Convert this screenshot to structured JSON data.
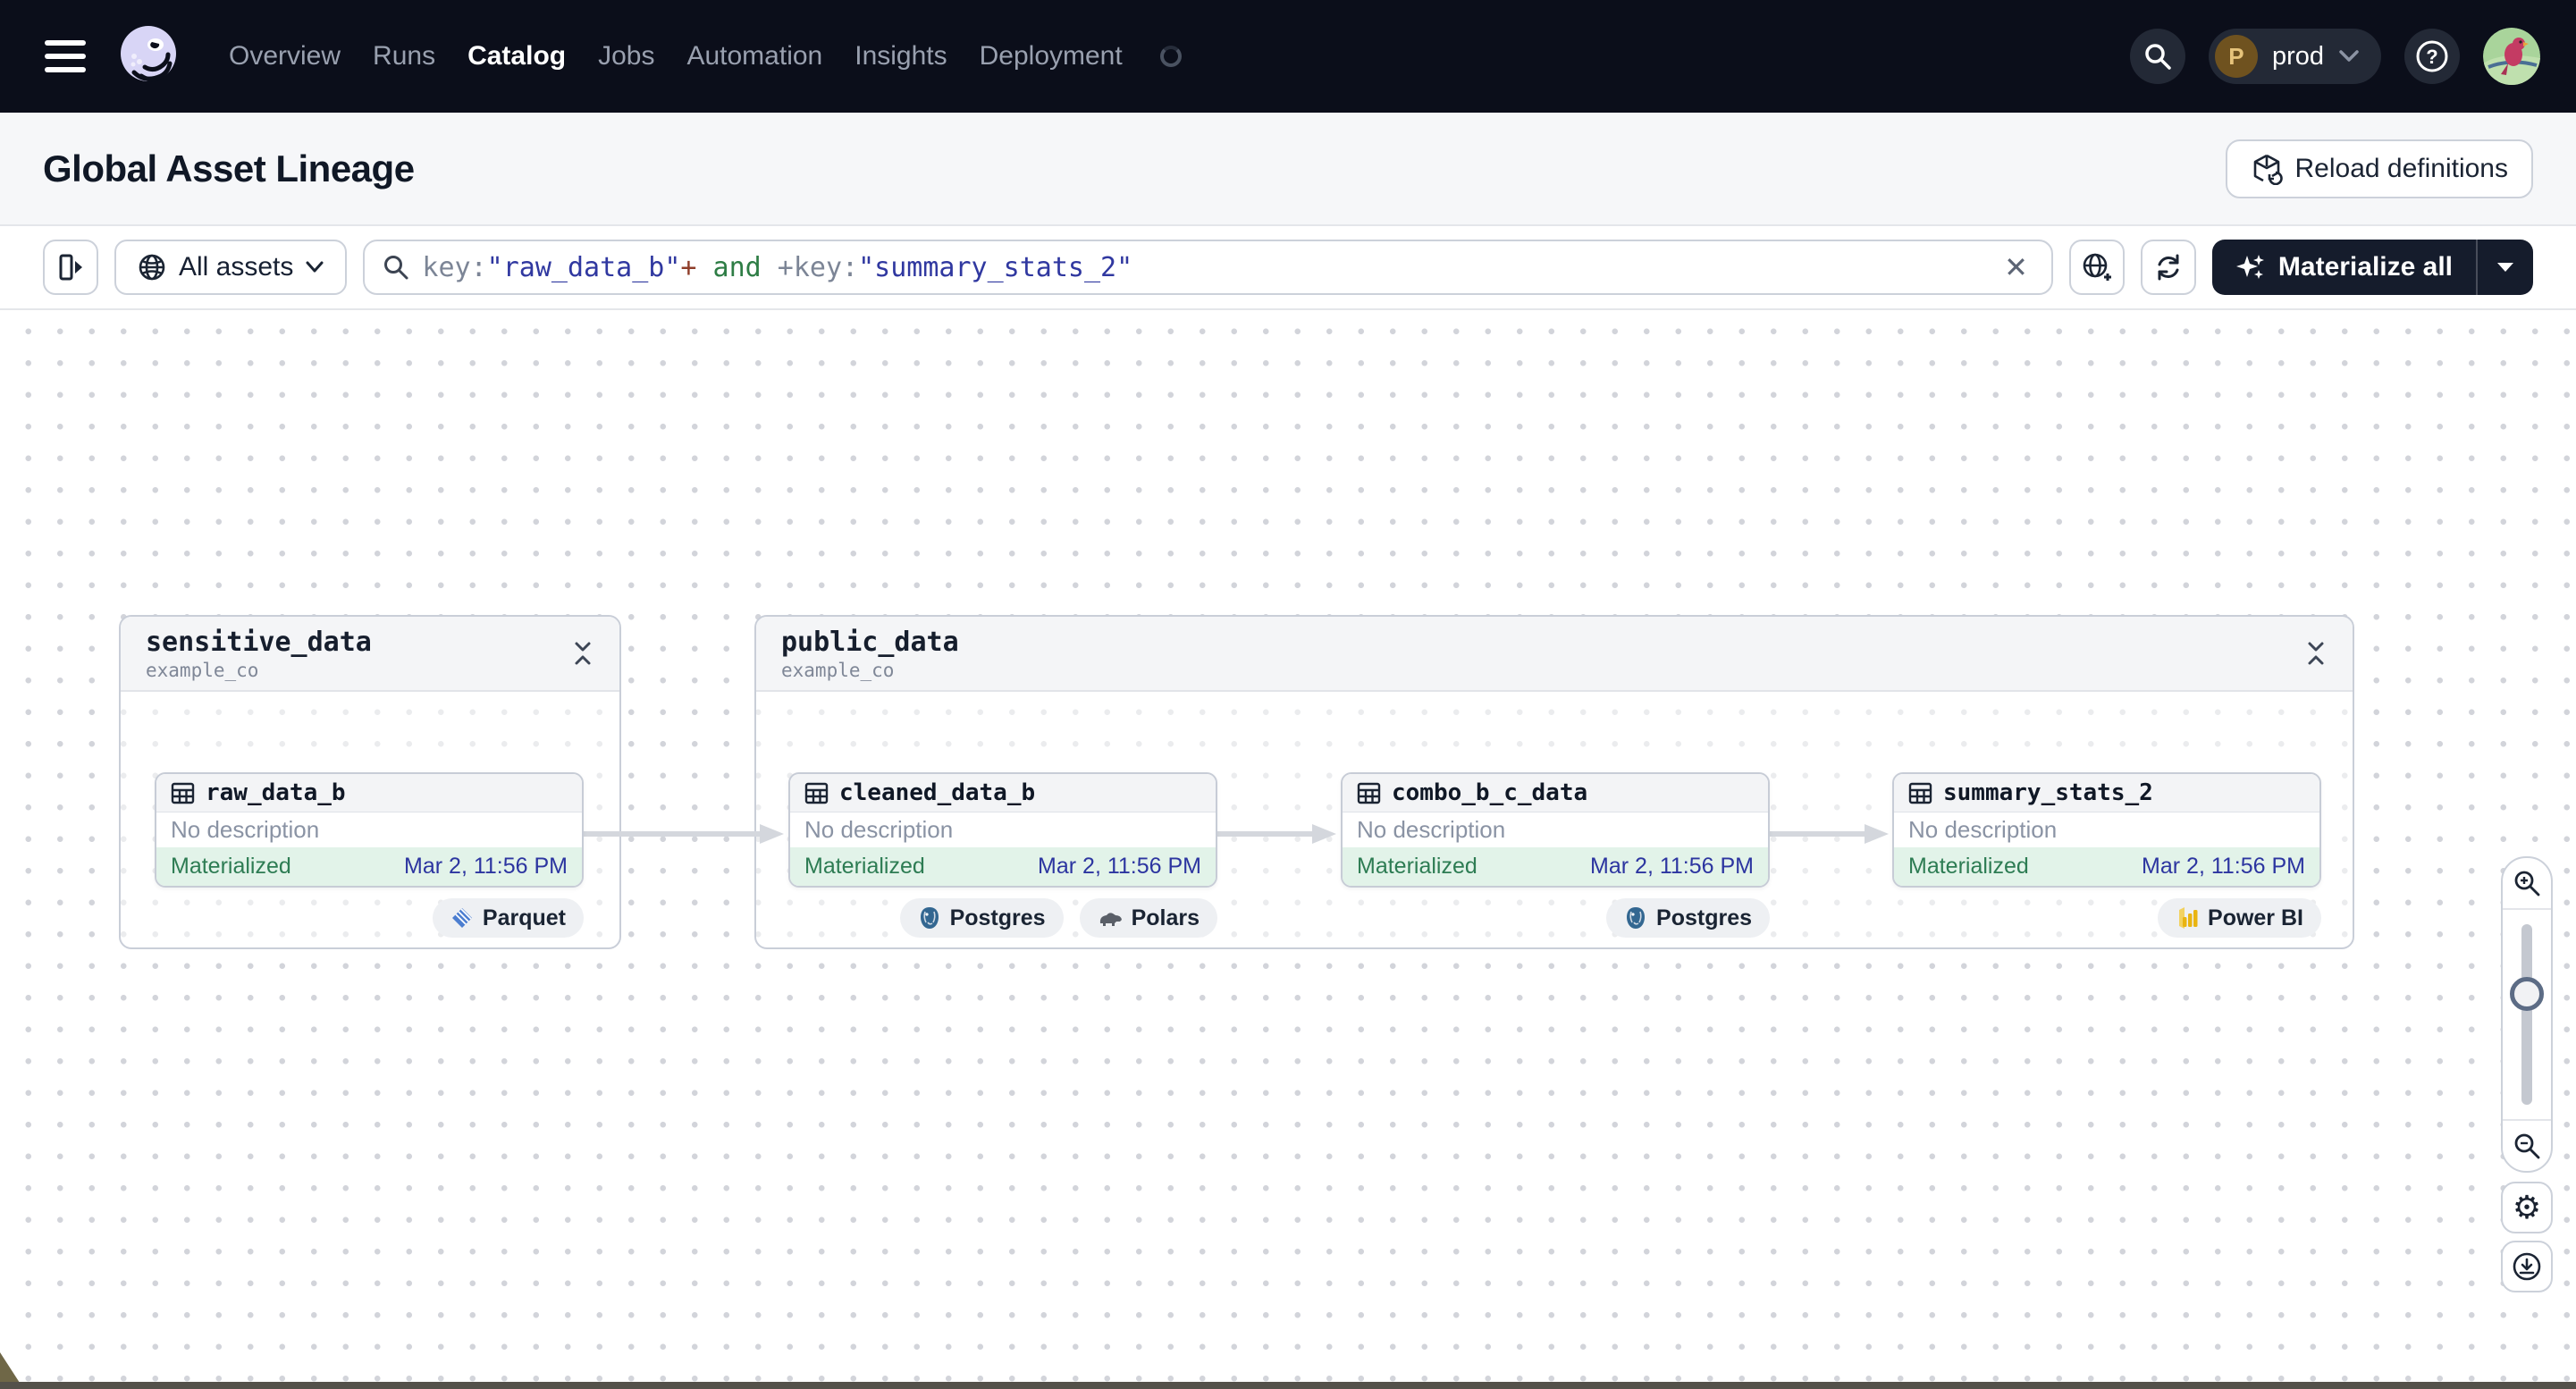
{
  "nav": {
    "items": [
      {
        "label": "Overview",
        "active": false
      },
      {
        "label": "Runs",
        "active": false
      },
      {
        "label": "Catalog",
        "active": true
      },
      {
        "label": "Jobs",
        "active": false
      },
      {
        "label": "Automation",
        "active": false
      },
      {
        "label": "Insights",
        "active": false
      },
      {
        "label": "Deployment",
        "active": false
      }
    ],
    "workspace": {
      "initial": "P",
      "label": "prod"
    }
  },
  "header": {
    "title": "Global Asset Lineage",
    "reload_label": "Reload definitions"
  },
  "filter_bar": {
    "scope_label": "All assets",
    "query": {
      "t1": "key:",
      "t2": "\"raw_data_b\"",
      "t3": "+",
      "t4": " and ",
      "t5": "+",
      "t6": "key:",
      "t7": "\"summary_stats_2\""
    },
    "materialize_label": "Materialize all"
  },
  "graph": {
    "groups": [
      {
        "name": "sensitive_data",
        "location": "example_co"
      },
      {
        "name": "public_data",
        "location": "example_co"
      }
    ],
    "assets": [
      {
        "name": "raw_data_b",
        "description": "No description",
        "status": "Materialized",
        "timestamp": "Mar 2, 11:56 PM",
        "tags": [
          "Parquet"
        ]
      },
      {
        "name": "cleaned_data_b",
        "description": "No description",
        "status": "Materialized",
        "timestamp": "Mar 2, 11:56 PM",
        "tags": [
          "Postgres",
          "Polars"
        ]
      },
      {
        "name": "combo_b_c_data",
        "description": "No description",
        "status": "Materialized",
        "timestamp": "Mar 2, 11:56 PM",
        "tags": [
          "Postgres"
        ]
      },
      {
        "name": "summary_stats_2",
        "description": "No description",
        "status": "Materialized",
        "timestamp": "Mar 2, 11:56 PM",
        "tags": [
          "Power BI"
        ]
      }
    ]
  },
  "icons": {
    "hamburger-icon": "three horizontal bars",
    "dagster-logo": "lavender octopus mark",
    "search-icon": "magnifier",
    "chevron-down-icon": "chevron down",
    "help-icon": "question mark in circle",
    "reload-icon": "cube with circular arrow",
    "panel-toggle-icon": "panel with right arrow",
    "globe-icon": "globe",
    "clear-icon": "x",
    "globe-add-icon": "globe with plus",
    "refresh-icon": "circular arrows",
    "sparkle-icon": "four point stars",
    "table-icon": "table grid",
    "collapse-icon": "chevrons pointing together",
    "parquet-icon": "blue striped diamond",
    "postgres-icon": "blue elephant",
    "polars-icon": "gray bear",
    "powerbi-icon": "yellow bar chart",
    "zoom-in-icon": "magnifier plus",
    "zoom-out-icon": "magnifier minus",
    "gear-icon": "gear",
    "download-icon": "arrow down in circle"
  },
  "colors": {
    "nav_bg": "#0b0e1a",
    "accent_dark_button": "#151c2c",
    "status_bg": "#e2f3e9",
    "status_green": "#2d7c53",
    "timestamp_blue": "#2c35a0",
    "query_string": "#3038a0",
    "query_operator_plus": "#8f3e2a",
    "query_operator_and": "#2e7d45"
  }
}
